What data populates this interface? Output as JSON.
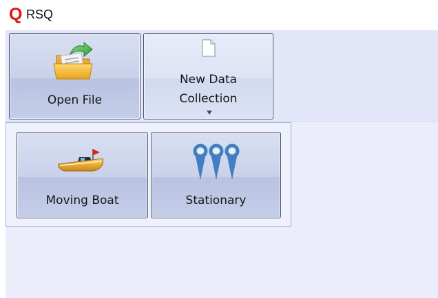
{
  "app": {
    "logo_text": "Q",
    "title": "RSQ",
    "logo_color": "#e01212"
  },
  "ribbon": {
    "background": "#e2e6f8",
    "buttons": [
      {
        "id": "open_file",
        "label": "Open File",
        "icon": "open-folder-icon"
      },
      {
        "id": "new_data_collection",
        "label_line1": "New Data",
        "label_line2": "Collection",
        "icon": "new-document-icon",
        "has_dropdown": true
      }
    ]
  },
  "dropdown": {
    "items": [
      {
        "id": "moving_boat",
        "label": "Moving Boat",
        "icon": "boat-icon"
      },
      {
        "id": "stationary",
        "label": "Stationary",
        "icon": "location-pins-icon"
      }
    ]
  },
  "colors": {
    "button_border": "#48506a",
    "panel_border": "#9bb3d6",
    "pin_color": "#3f7fc2"
  }
}
